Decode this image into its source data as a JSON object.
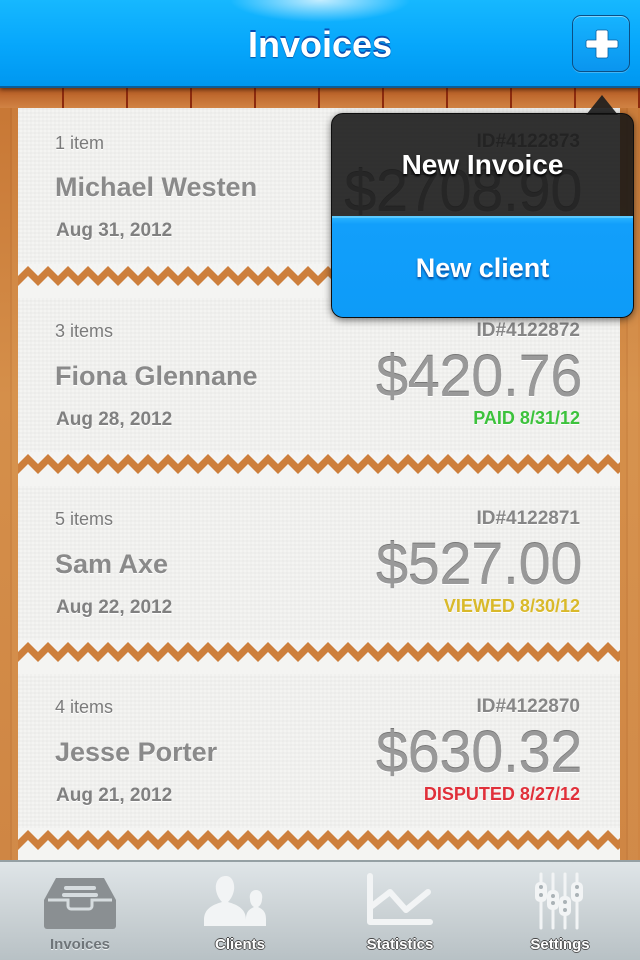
{
  "header": {
    "title": "Invoices",
    "add_button_icon": "plus-icon"
  },
  "popup_menu": {
    "items": [
      {
        "label": "New Invoice",
        "style": "dark"
      },
      {
        "label": "New client",
        "style": "blue"
      }
    ]
  },
  "invoices": [
    {
      "items": "1 item",
      "client": "Michael Westen",
      "date": "Aug 31, 2012",
      "id": "ID#4122873",
      "amount": "$2708.90",
      "status": "",
      "status_color": ""
    },
    {
      "items": "3 items",
      "client": "Fiona Glennane",
      "date": "Aug 28, 2012",
      "id": "ID#4122872",
      "amount": "$420.76",
      "status": "PAID 8/31/12",
      "status_color": "#3cc23c"
    },
    {
      "items": "5 items",
      "client": "Sam Axe",
      "date": "Aug 22, 2012",
      "id": "ID#4122871",
      "amount": "$527.00",
      "status": "VIEWED 8/30/12",
      "status_color": "#d9b92a"
    },
    {
      "items": "4 items",
      "client": "Jesse Porter",
      "date": "Aug 21, 2012",
      "id": "ID#4122870",
      "amount": "$630.32",
      "status": "DISPUTED 8/27/12",
      "status_color": "#e0303a"
    }
  ],
  "tabbar": {
    "tabs": [
      {
        "label": "Invoices",
        "icon": "inbox-tray-icon",
        "active": true
      },
      {
        "label": "Clients",
        "icon": "people-icon",
        "active": false
      },
      {
        "label": "Statistics",
        "icon": "line-chart-icon",
        "active": false
      },
      {
        "label": "Settings",
        "icon": "sliders-icon",
        "active": false
      }
    ]
  },
  "colors": {
    "header_blue": "#06a6fb",
    "paid": "#3cc23c",
    "viewed": "#d9b92a",
    "disputed": "#e0303a"
  }
}
